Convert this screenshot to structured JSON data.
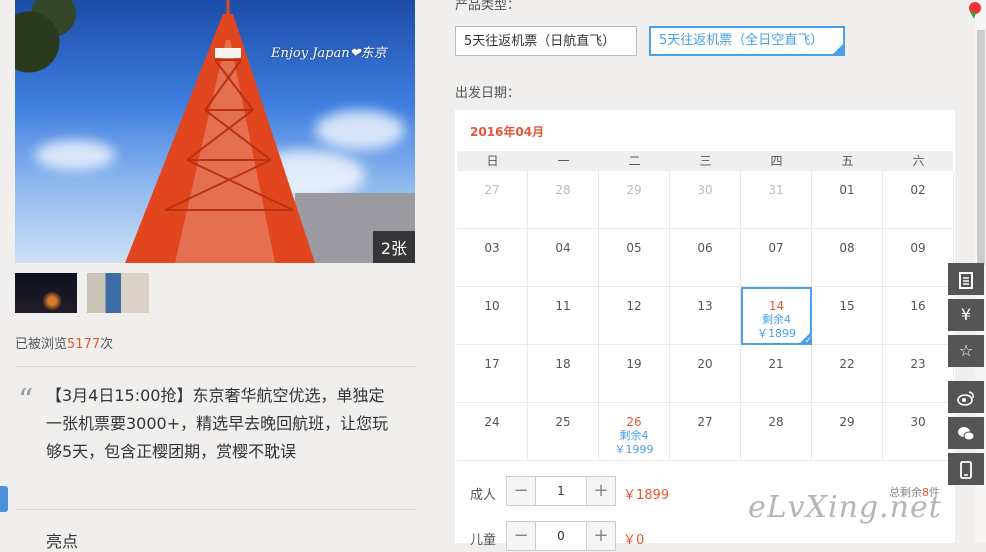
{
  "hero": {
    "overlay_text": "Enjoy Japan❤东京",
    "image_count": "2张"
  },
  "stats": {
    "views_prefix": "已被浏览",
    "views_count": "5177",
    "views_suffix": "次"
  },
  "description": "【3月4日15:00抢】东京奢华航空优选，单独定一张机票要3000+，精选早去晚回航班，让您玩够5天，包含正樱团期，赏樱不耽误",
  "highlight_title": "亮点",
  "product": {
    "label": "产品类型：",
    "options": [
      {
        "label": "5天往返机票（日航直飞）",
        "selected": false
      },
      {
        "label": "5天往返机票（全日空直飞）",
        "selected": true
      }
    ]
  },
  "calendar": {
    "label": "出发日期：",
    "month": "2016年04月",
    "weekdays": [
      "日",
      "一",
      "二",
      "三",
      "四",
      "五",
      "六"
    ],
    "weeks": [
      [
        {
          "d": "27",
          "m": true
        },
        {
          "d": "28",
          "m": true
        },
        {
          "d": "29",
          "m": true
        },
        {
          "d": "30",
          "m": true
        },
        {
          "d": "31",
          "m": true
        },
        {
          "d": "01"
        },
        {
          "d": "02"
        }
      ],
      [
        {
          "d": "03"
        },
        {
          "d": "04"
        },
        {
          "d": "05"
        },
        {
          "d": "06"
        },
        {
          "d": "07"
        },
        {
          "d": "08"
        },
        {
          "d": "09"
        }
      ],
      [
        {
          "d": "10"
        },
        {
          "d": "11"
        },
        {
          "d": "12"
        },
        {
          "d": "13"
        },
        {
          "d": "14",
          "r": true,
          "sel": true,
          "s1": "剩余4",
          "s2": "￥1899"
        },
        {
          "d": "15"
        },
        {
          "d": "16"
        }
      ],
      [
        {
          "d": "17"
        },
        {
          "d": "18"
        },
        {
          "d": "19"
        },
        {
          "d": "20"
        },
        {
          "d": "21"
        },
        {
          "d": "22"
        },
        {
          "d": "23"
        }
      ],
      [
        {
          "d": "24"
        },
        {
          "d": "25"
        },
        {
          "d": "26",
          "r": true,
          "s1": "剩余4",
          "s2": "￥1999"
        },
        {
          "d": "27"
        },
        {
          "d": "28"
        },
        {
          "d": "29"
        },
        {
          "d": "30"
        }
      ]
    ]
  },
  "booking": {
    "adult_label": "成人",
    "adult_qty": "1",
    "adult_price": "￥1899",
    "child_label": "儿童",
    "child_qty": "0",
    "child_price": "￥0",
    "remain_prefix": "总剩余",
    "remain_count": "8",
    "remain_suffix": "件"
  },
  "watermark": "eLvXing.net",
  "sidebar": [
    "clipboard-icon",
    "yen-icon",
    "star-icon",
    "weibo-icon",
    "wechat-icon",
    "mobile-icon"
  ],
  "colors": {
    "accent": "#4aa0e8",
    "price": "#e8563a"
  }
}
